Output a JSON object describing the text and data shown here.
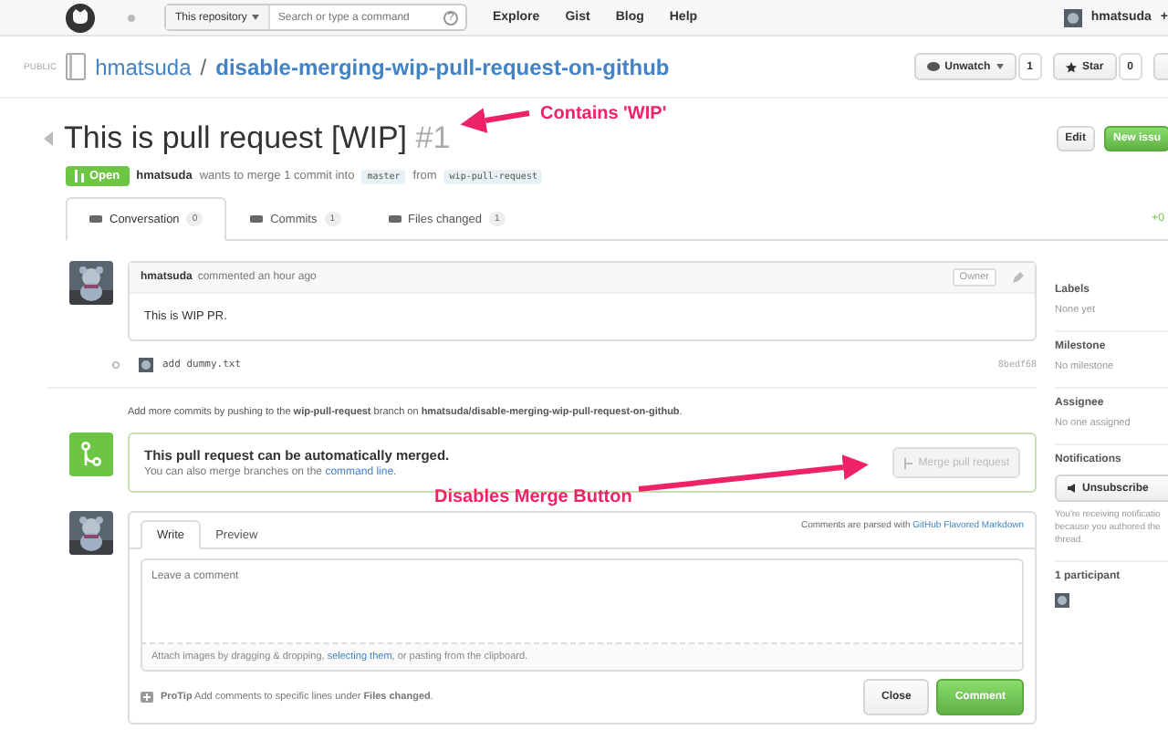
{
  "header": {
    "scope": "This repository",
    "search_placeholder": "Search or type a command",
    "help": "?",
    "nav": [
      "Explore",
      "Gist",
      "Blog",
      "Help"
    ],
    "user": "hmatsuda",
    "plus": "+"
  },
  "repo": {
    "visibility": "PUBLIC",
    "owner": "hmatsuda",
    "separator": "/",
    "name": "disable-merging-wip-pull-request-on-github",
    "actions": [
      {
        "label": "Unwatch",
        "count": "1",
        "kind": "dropdown"
      },
      {
        "label": "Star",
        "count": "0",
        "kind": "plain"
      }
    ]
  },
  "pull_request": {
    "title": "This is pull request [WIP]",
    "number": "#1",
    "buttons": [
      {
        "label": "Edit",
        "kind": "default"
      },
      {
        "label": "New issu",
        "kind": "primary"
      }
    ],
    "state": "Open",
    "author": "hmatsuda",
    "action": "wants to merge 1 commit into",
    "base": "master",
    "from": "from",
    "head": "wip-pull-request"
  },
  "tabs": [
    {
      "label": "Conversation",
      "count": "0",
      "selected": true
    },
    {
      "label": "Commits",
      "count": "1",
      "selected": false
    },
    {
      "label": "Files changed",
      "count": "1",
      "selected": false
    }
  ],
  "diffstat": "+0",
  "comment": {
    "author": "hmatsuda",
    "time": "commented an hour ago",
    "role": "Owner",
    "body": "This is WIP PR."
  },
  "commit": {
    "message": "add dummy.txt",
    "sha": "8bedf68"
  },
  "push_hint": "Add more commits by pushing to the **wip-pull-request** branch on **hmatsuda/disable-merging-wip-pull-request-on-github**.",
  "merge": {
    "title": "This pull request can be automatically merged.",
    "hint": "You can also merge branches on the",
    "link": "command line",
    "hint_end": ".",
    "button": {
      "label": "Merge pull request",
      "disabled": true
    }
  },
  "new_comment": {
    "tabs": [
      {
        "label": "Write",
        "selected": true
      },
      {
        "label": "Preview",
        "selected": false
      }
    ],
    "markdown_note": "Comments are parsed with",
    "markdown_link": "GitHub Flavored Markdown",
    "placeholder": "Leave a comment",
    "attach_start": "Attach images by dragging & dropping,",
    "attach_link": "selecting them",
    "attach_end": ", or pasting from the clipboard.",
    "protip": "**ProTip** Add comments to specific lines under **Files changed**.",
    "buttons": [
      {
        "label": "Close",
        "kind": "default"
      },
      {
        "label": "Comment",
        "kind": "primary"
      }
    ]
  },
  "sidebar": {
    "sections": [
      {
        "heading": "Labels",
        "value": "None yet"
      },
      {
        "heading": "Milestone",
        "value": "No milestone"
      },
      {
        "heading": "Assignee",
        "value": "No one assigned"
      }
    ],
    "notifications": {
      "heading": "Notifications",
      "button": "Unsubscribe",
      "lines": [
        "You're receiving notificatio",
        "because you authored the",
        "thread."
      ]
    },
    "participants": "1 participant"
  },
  "annotations": [
    {
      "text": "Contains 'WIP'"
    },
    {
      "text": "Disables Merge Button"
    }
  ]
}
